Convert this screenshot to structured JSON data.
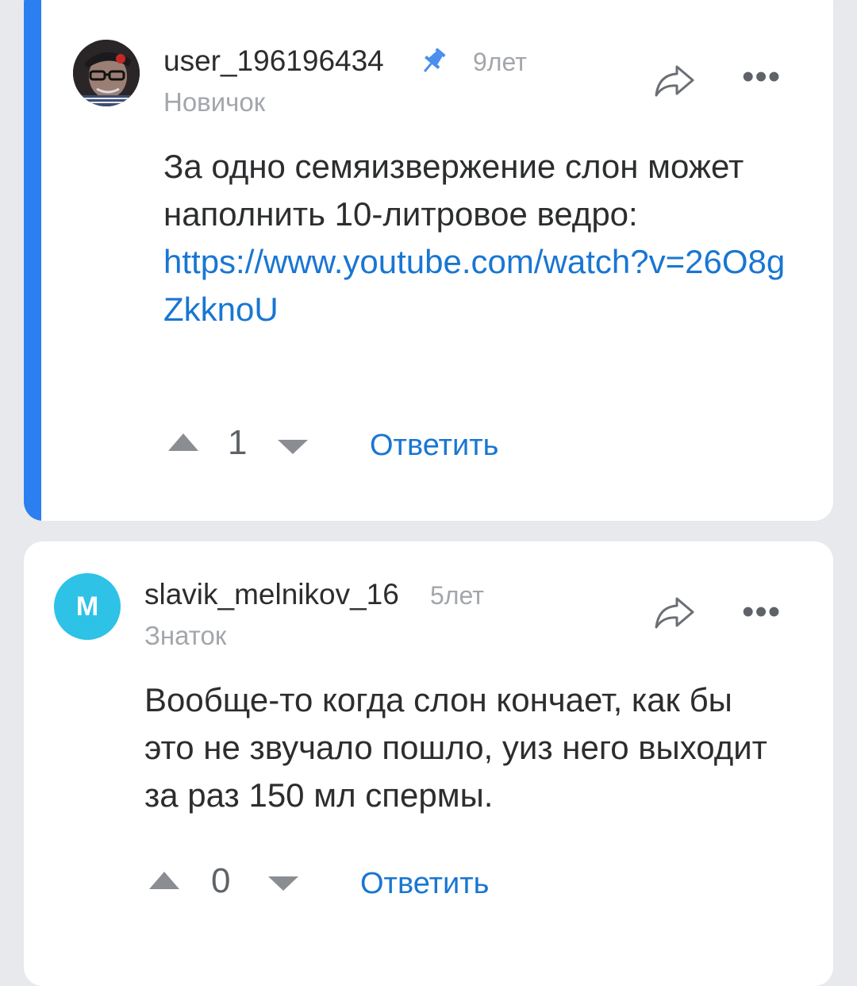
{
  "comments": [
    {
      "username": "user_196196434",
      "time": "9лет",
      "rank": "Новичок",
      "text": "За одно семяизвержение слон может наполнить 10-литровое ведро:",
      "link": "https://www.youtube.com/watch?v=26O8gZkknoU",
      "score": "1",
      "reply_label": "Ответить",
      "pinned": true,
      "avatar_icon": "user-photo"
    },
    {
      "username": "slavik_melnikov_16",
      "time": "5лет",
      "rank": "Знаток",
      "text": "Вообще-то когда слон кончает, как бы это не звучало пошло, уиз него выходит за раз 150 мл спермы.",
      "score": "0",
      "reply_label": "Ответить",
      "avatar_letter": "M",
      "avatar_color": "#2ec2e6"
    }
  ],
  "colors": {
    "accent": "#2b7ff0",
    "link": "#1976d2",
    "background": "#e8e9ec"
  }
}
